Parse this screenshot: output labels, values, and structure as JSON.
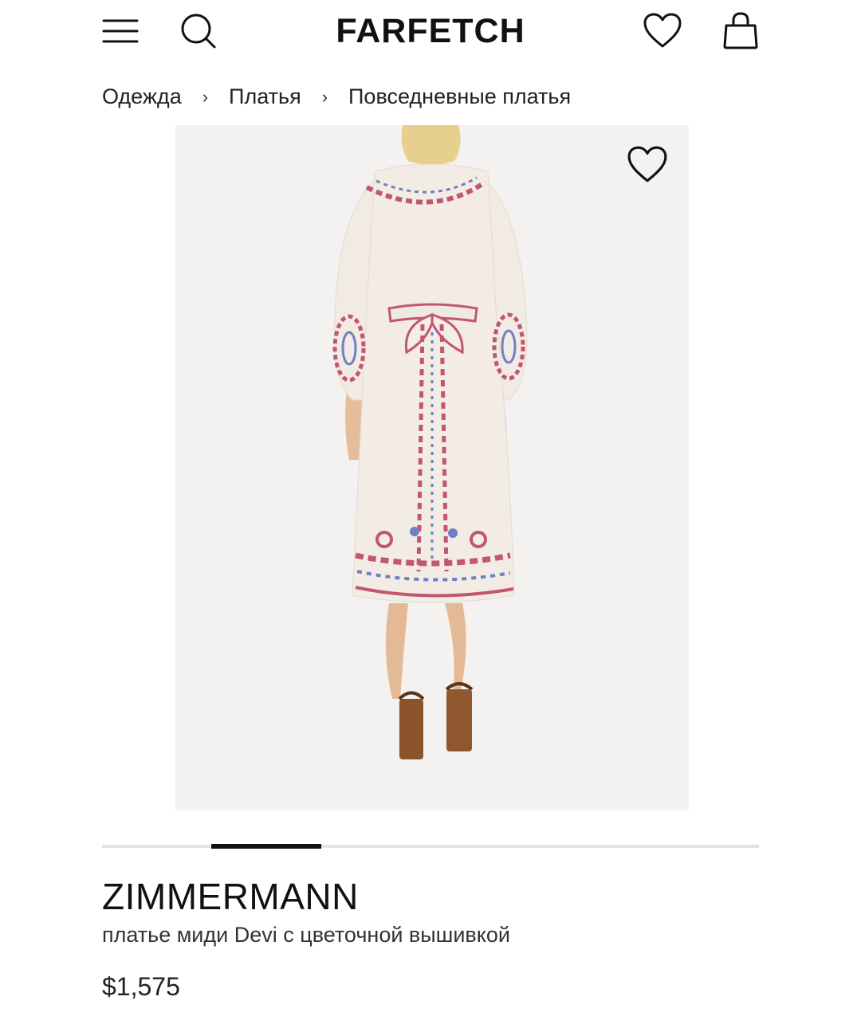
{
  "header": {
    "logo": "FARFETCH",
    "icons": [
      "menu-icon",
      "search-icon",
      "heart-icon",
      "shopping-bag-icon"
    ]
  },
  "breadcrumb": {
    "items": [
      "Одежда",
      "Платья",
      "Повседневные платья"
    ],
    "separator": "›"
  },
  "gallery": {
    "current_index": 2,
    "total": 6,
    "wishlist_icon": "heart-icon"
  },
  "product": {
    "brand": "ZIMMERMANN",
    "name": "платье миди Devi с цветочной вышивкой",
    "price": "$1,575"
  },
  "colors": {
    "text": "#222222",
    "accent": "#111111",
    "image_bg": "#f3f2f0",
    "track": "#e3e3e3"
  }
}
